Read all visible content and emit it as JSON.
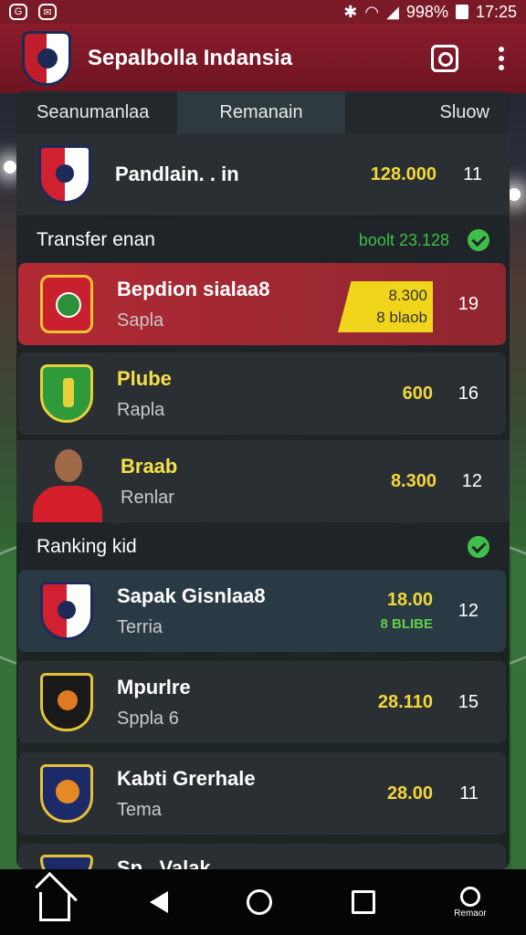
{
  "status_bar": {
    "battery": "998%",
    "time": "17:25"
  },
  "app": {
    "title": "Sepalbolla Indansia"
  },
  "tabs": [
    "Seanumanlaa",
    "Remanain",
    "Sluow"
  ],
  "top_row": {
    "name": "Pandlain. . in",
    "value": "128.000",
    "rank": "11"
  },
  "transfer_section": {
    "title": "Transfer enan",
    "meta": "boolt 23.128"
  },
  "transfer_rows": [
    {
      "name": "Bepdion sialaa8",
      "sub": "Sapla",
      "value_line1": "8.300",
      "value_line2": "8 blaob",
      "rank": "19"
    },
    {
      "name": "Plube",
      "sub": "Rapla",
      "value": "600",
      "rank": "16"
    },
    {
      "name": "Braab",
      "sub": "Renlar",
      "value": "8.300",
      "rank": "12"
    }
  ],
  "ranking_section": {
    "title": "Ranking kid"
  },
  "ranking_rows": [
    {
      "name": "Sapak Gisnlaa8",
      "sub": "Terria",
      "value": "18.00",
      "value_sub": "8 BLIBE",
      "rank": "12"
    },
    {
      "name": "Mpurlre",
      "sub": "Sppla  6",
      "value": "28.110",
      "rank": "15"
    },
    {
      "name": "Kabti Grerhale",
      "sub": "Tema",
      "value": "28.00",
      "rank": "11"
    },
    {
      "name": "Sp...Valak"
    }
  ],
  "nav": {
    "profile_label": "Remaor"
  },
  "colors": {
    "brand": "#7a1a26",
    "accent": "#f2d83a",
    "positive": "#3fbf4a"
  }
}
